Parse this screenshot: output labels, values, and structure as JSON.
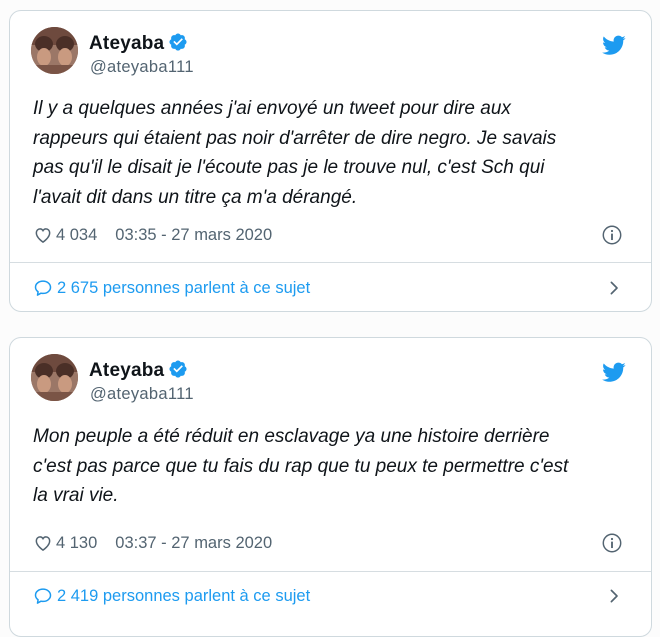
{
  "colors": {
    "accent": "#1d9bf0",
    "text": "#0f1419",
    "secondary": "#536471"
  },
  "tweets": [
    {
      "display_name": "Ateyaba",
      "handle": "@ateyaba111",
      "text": "Il y a quelques années j'ai envoyé un tweet pour dire aux\nrappeurs qui étaient pas noir d'arrêter de dire negro. Je savais\npas qu'il le disait je l'écoute pas je le trouve nul, c'est Sch qui\nl'avait dit dans un titre ça m'a dérangé.",
      "likes": "4 034",
      "timestamp": "03:35 - 27 mars 2020",
      "conversation": "2 675 personnes parlent à ce sujet",
      "icons": [
        "verified-icon",
        "twitter-bird-icon",
        "heart-icon",
        "info-icon",
        "speech-bubble-icon",
        "chevron-right-icon"
      ]
    },
    {
      "display_name": "Ateyaba",
      "handle": "@ateyaba111",
      "text": "Mon peuple a été réduit en esclavage ya une histoire derrière\nc'est pas parce que tu fais du rap que tu peux te permettre c'est\nla vrai vie.",
      "likes": "4 130",
      "timestamp": "03:37 - 27 mars 2020",
      "conversation": "2 419 personnes parlent à ce sujet",
      "icons": [
        "verified-icon",
        "twitter-bird-icon",
        "heart-icon",
        "info-icon",
        "speech-bubble-icon",
        "chevron-right-icon"
      ]
    }
  ]
}
